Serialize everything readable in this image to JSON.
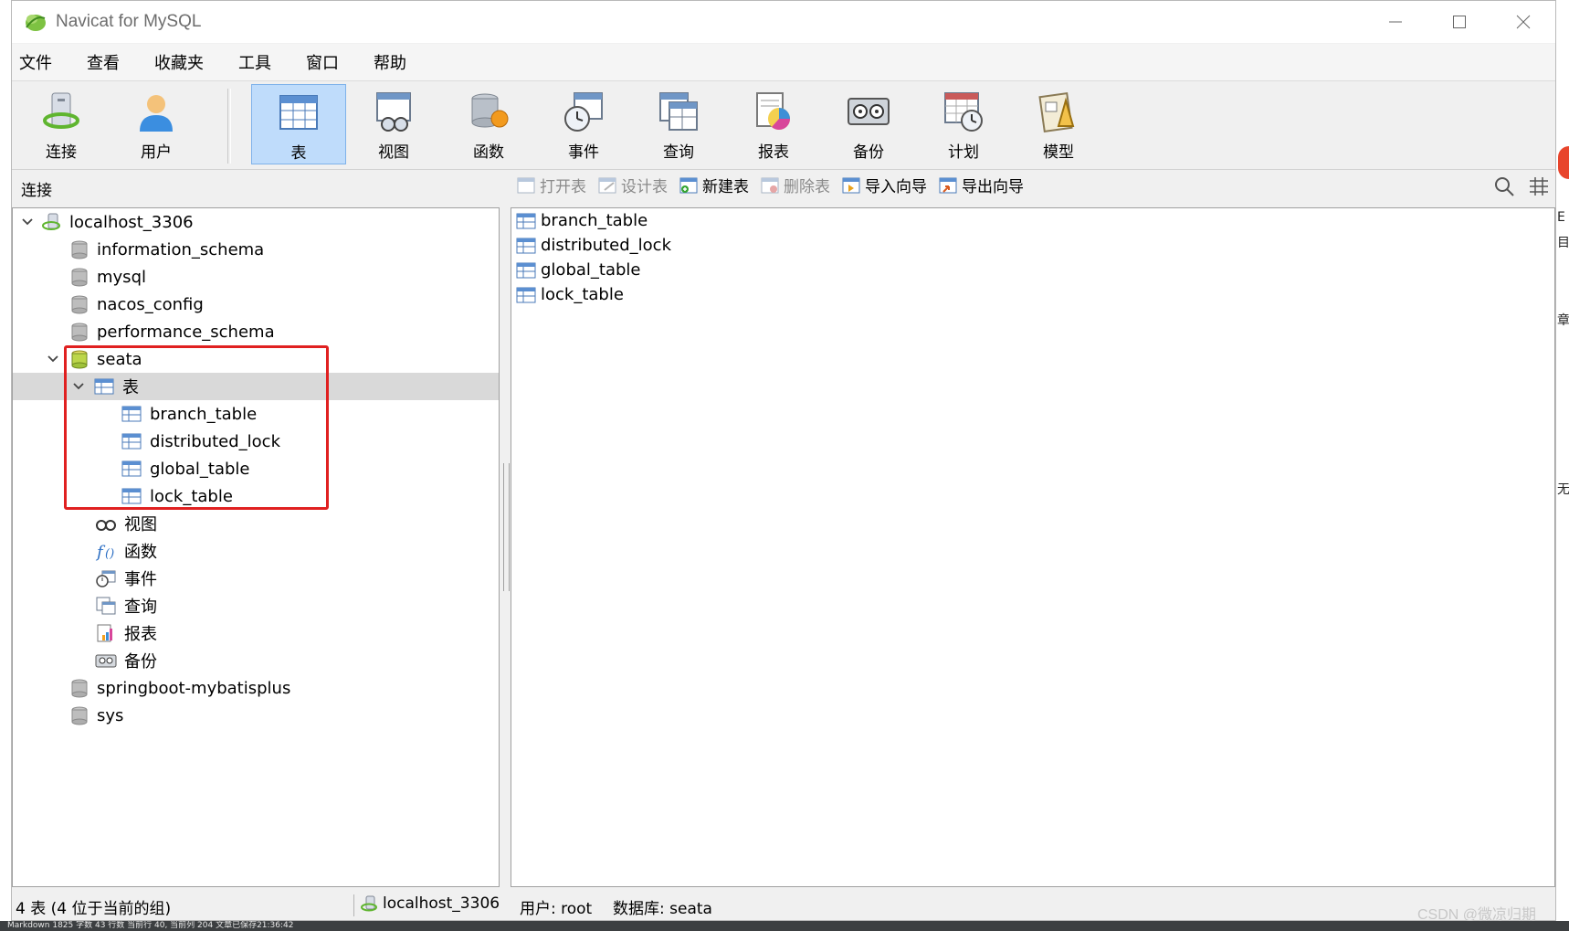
{
  "window": {
    "title": "Navicat for MySQL"
  },
  "menu": [
    "文件",
    "查看",
    "收藏夹",
    "工具",
    "窗口",
    "帮助"
  ],
  "toolbar": [
    {
      "label": "连接",
      "icon": "connection-icon"
    },
    {
      "label": "用户",
      "icon": "user-icon"
    },
    {
      "label": "表",
      "icon": "table-icon",
      "active": true
    },
    {
      "label": "视图",
      "icon": "view-icon"
    },
    {
      "label": "函数",
      "icon": "function-icon"
    },
    {
      "label": "事件",
      "icon": "event-icon"
    },
    {
      "label": "查询",
      "icon": "query-icon"
    },
    {
      "label": "报表",
      "icon": "report-icon"
    },
    {
      "label": "备份",
      "icon": "backup-icon"
    },
    {
      "label": "计划",
      "icon": "schedule-icon"
    },
    {
      "label": "模型",
      "icon": "model-icon"
    }
  ],
  "panel": {
    "connection_title": "连接",
    "object_actions": [
      {
        "label": "打开表",
        "enabled": false
      },
      {
        "label": "设计表",
        "enabled": false
      },
      {
        "label": "新建表",
        "enabled": true
      },
      {
        "label": "删除表",
        "enabled": false
      },
      {
        "label": "导入向导",
        "enabled": true
      },
      {
        "label": "导出向导",
        "enabled": true
      }
    ]
  },
  "tree": {
    "connection": "localhost_3306",
    "databases": [
      "information_schema",
      "mysql",
      "nacos_config",
      "performance_schema"
    ],
    "open_db": "seata",
    "tables_folder": "表",
    "tables": [
      "branch_table",
      "distributed_lock",
      "global_table",
      "lock_table"
    ],
    "other_folders": [
      "视图",
      "函数",
      "事件",
      "查询",
      "报表",
      "备份"
    ],
    "more_databases": [
      "springboot-mybatisplus",
      "sys"
    ]
  },
  "objects": [
    "branch_table",
    "distributed_lock",
    "global_table",
    "lock_table"
  ],
  "status": {
    "count": "4 表 (4 位于当前的组)",
    "connection": "localhost_3306",
    "user": "用户: root",
    "database": "数据库: seata"
  },
  "outside": {
    "markdown_status": "Markdown  1825 字数  43 行数  当前行 40, 当前列 204  文章已保存21:36:42",
    "watermark": "CSDN @微凉归期",
    "side_chars": [
      "E",
      "目",
      "章",
      "无"
    ]
  },
  "colors": {
    "active_tool_bg": "#bfdcfb",
    "highlight_border": "#e02020",
    "selected_row": "#d9d9d9"
  }
}
